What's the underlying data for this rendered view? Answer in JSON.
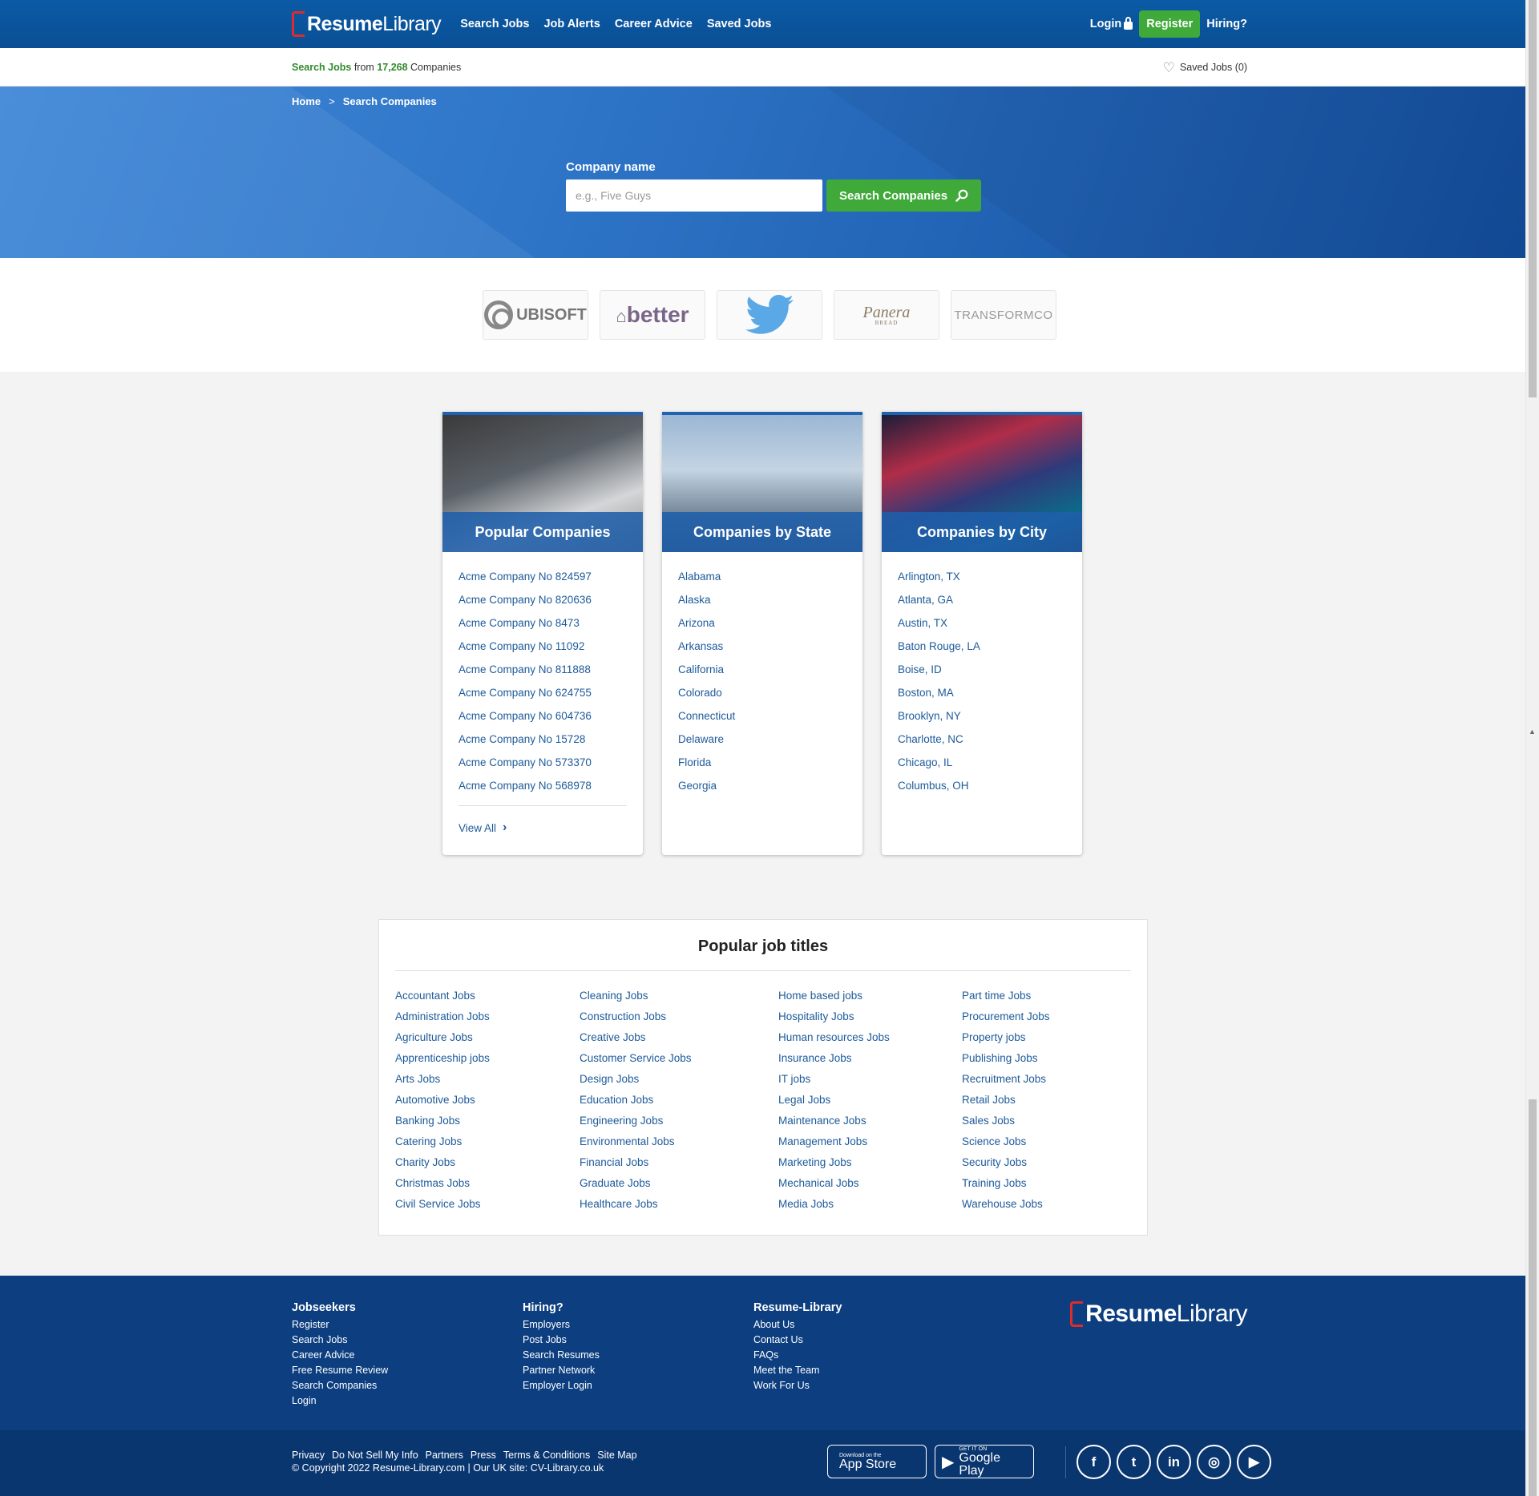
{
  "header": {
    "logo_a": "Resume",
    "logo_b": "Library",
    "nav": [
      "Search Jobs",
      "Job Alerts",
      "Career Advice",
      "Saved Jobs"
    ],
    "login": "Login",
    "register": "Register",
    "hiring": "Hiring?"
  },
  "subbar": {
    "search_jobs": "Search Jobs",
    "from": "from",
    "count": "17,268",
    "companies": "Companies",
    "saved": "Saved Jobs (0)"
  },
  "hero": {
    "crumb_home": "Home",
    "crumb_sep": ">",
    "crumb_current": "Search Companies",
    "label": "Company name",
    "placeholder": "e.g., Five Guys",
    "button": "Search Companies"
  },
  "logos": {
    "ubisoft": "UBISOFT",
    "better": "better",
    "panera": "Panera",
    "panera_sub": "BREAD",
    "transform": "TRANSFORMCO"
  },
  "cards": [
    {
      "title": "Popular Companies",
      "items": [
        "Acme Company No 824597",
        "Acme Company No 820636",
        "Acme Company No 8473",
        "Acme Company No 11092",
        "Acme Company No 811888",
        "Acme Company No 624755",
        "Acme Company No 604736",
        "Acme Company No 15728",
        "Acme Company No 573370",
        "Acme Company No 568978"
      ],
      "view_all": "View All"
    },
    {
      "title": "Companies by State",
      "items": [
        "Alabama",
        "Alaska",
        "Arizona",
        "Arkansas",
        "California",
        "Colorado",
        "Connecticut",
        "Delaware",
        "Florida",
        "Georgia"
      ]
    },
    {
      "title": "Companies by City",
      "items": [
        "Arlington, TX",
        "Atlanta, GA",
        "Austin, TX",
        "Baton Rouge, LA",
        "Boise, ID",
        "Boston, MA",
        "Brooklyn, NY",
        "Charlotte, NC",
        "Chicago, IL",
        "Columbus, OH"
      ]
    }
  ],
  "popular": {
    "title": "Popular job titles",
    "columns": [
      [
        "Accountant Jobs",
        "Administration Jobs",
        "Agriculture Jobs",
        "Apprenticeship jobs",
        "Arts Jobs",
        "Automotive Jobs",
        "Banking Jobs",
        "Catering Jobs",
        "Charity Jobs",
        "Christmas Jobs",
        "Civil Service Jobs"
      ],
      [
        "Cleaning Jobs",
        "Construction Jobs",
        "Creative Jobs",
        "Customer Service Jobs",
        "Design Jobs",
        "Education Jobs",
        "Engineering Jobs",
        "Environmental Jobs",
        "Financial Jobs",
        "Graduate Jobs",
        "Healthcare Jobs"
      ],
      [
        "Home based jobs",
        "Hospitality Jobs",
        "Human resources Jobs",
        "Insurance Jobs",
        "IT jobs",
        "Legal Jobs",
        "Maintenance Jobs",
        "Management Jobs",
        "Marketing Jobs",
        "Mechanical Jobs",
        "Media Jobs"
      ],
      [
        "Part time Jobs",
        "Procurement Jobs",
        "Property jobs",
        "Publishing Jobs",
        "Recruitment Jobs",
        "Retail Jobs",
        "Sales Jobs",
        "Science Jobs",
        "Security Jobs",
        "Training Jobs",
        "Warehouse Jobs"
      ]
    ]
  },
  "footer": {
    "cols": [
      {
        "title": "Jobseekers",
        "links": [
          "Register",
          "Search Jobs",
          "Career Advice",
          "Free Resume Review",
          "Search Companies",
          "Login"
        ]
      },
      {
        "title": "Hiring?",
        "links": [
          "Employers",
          "Post Jobs",
          "Search Resumes",
          "Partner Network",
          "Employer Login"
        ]
      },
      {
        "title": "Resume-Library",
        "links": [
          "About Us",
          "Contact Us",
          "FAQs",
          "Meet the Team",
          "Work For Us"
        ]
      }
    ],
    "bottom_links": [
      "Privacy",
      "Do Not Sell My Info",
      "Partners",
      "Press",
      "Terms & Conditions",
      "Site Map"
    ],
    "copyright": "© Copyright 2022 Resume-Library.com | Our UK site: CV-Library.co.uk",
    "appstore_small": "Download on the",
    "appstore": "App Store",
    "gplay_small": "GET IT ON",
    "gplay": "Google Play",
    "social": [
      "f",
      "t",
      "in",
      "ig",
      "yt"
    ]
  },
  "icons": [
    "lock-icon",
    "heart-icon",
    "search-icon",
    "chevron-right-icon",
    "apple-icon",
    "google-play-icon",
    "facebook-icon",
    "twitter-icon",
    "linkedin-icon",
    "instagram-icon",
    "youtube-icon"
  ],
  "colors": {
    "brand_blue": "#0b5aa6",
    "green": "#3fa93a",
    "link": "#1d5a9a",
    "footer": "#0c3e80",
    "logo_red": "#e02b2b"
  }
}
